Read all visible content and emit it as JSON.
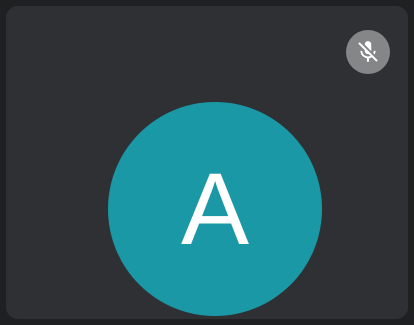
{
  "participant": {
    "initial": "A"
  },
  "icons": {
    "mic_status": "mic-off-icon"
  },
  "colors": {
    "background": "#1f2022",
    "tile": "#2f3033",
    "avatar": "#1a98a6",
    "mute_badge": "#858687"
  }
}
